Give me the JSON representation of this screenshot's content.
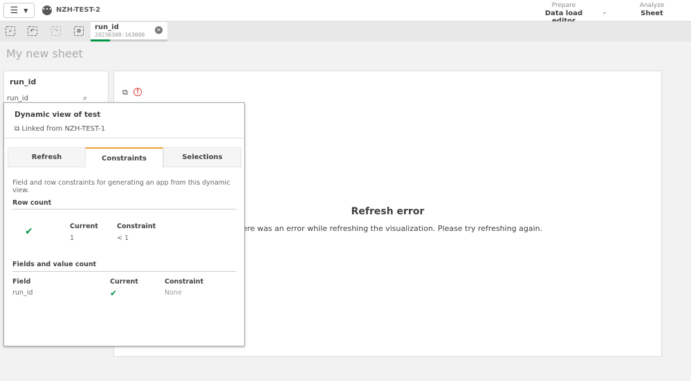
{
  "app": {
    "name": "NZH-TEST-2"
  },
  "nav": {
    "prepare_label": "Prepare",
    "prepare_value": "Data load editor",
    "analyze_label": "Analyze",
    "analyze_value": "Sheet"
  },
  "selection": {
    "field": "run_id",
    "value": "20230308-163000"
  },
  "sheet": {
    "title": "My new sheet"
  },
  "filter_pane": {
    "title": "run_id",
    "search_value": "run_id"
  },
  "viz": {
    "error_title": "Refresh error",
    "error_message": "There was an error while refreshing the visualization. Please try refreshing again."
  },
  "popup": {
    "title": "Dynamic view of test",
    "linked": "Linked from NZH-TEST-1",
    "tabs": [
      {
        "label": "Refresh"
      },
      {
        "label": "Constraints"
      },
      {
        "label": "Selections"
      }
    ],
    "active_tab": "Constraints",
    "description": "Field and row constraints for generating an app from this dynamic view.",
    "row_count": {
      "heading": "Row count",
      "current_label": "Current",
      "constraint_label": "Constraint",
      "current": "1",
      "constraint": "< 1"
    },
    "fields": {
      "heading": "Fields and value count",
      "col_field": "Field",
      "col_current": "Current",
      "col_constraint": "Constraint",
      "rows": [
        {
          "field": "run_id",
          "constraint": "None"
        }
      ]
    }
  },
  "colors": {
    "accent": "#f0a030",
    "success": "#009845",
    "error": "#dc423c"
  }
}
